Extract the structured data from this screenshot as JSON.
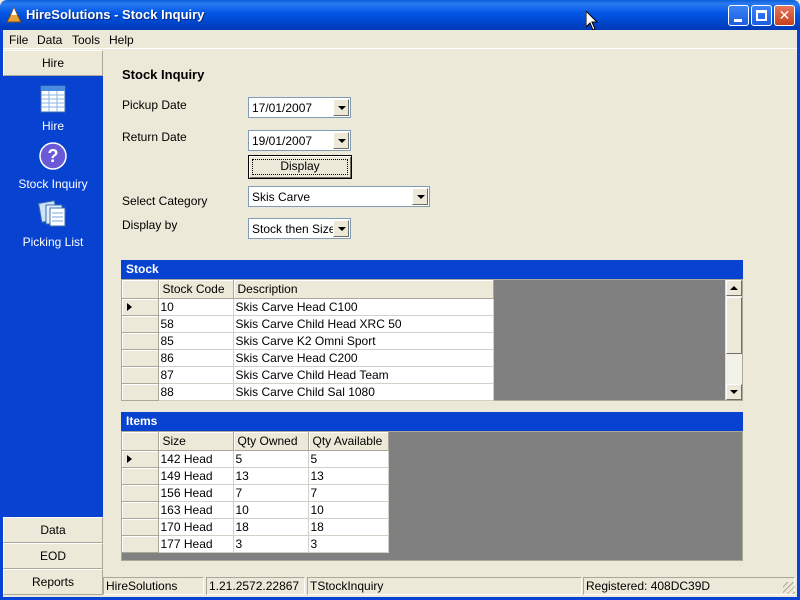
{
  "window": {
    "title": "HireSolutions - Stock Inquiry"
  },
  "menu": [
    "File",
    "Data",
    "Tools",
    "Help"
  ],
  "nav": {
    "top_header": "Hire",
    "links": [
      {
        "label": "Hire",
        "icon": "spreadsheet-icon"
      },
      {
        "label": "Stock Inquiry",
        "icon": "question-icon"
      },
      {
        "label": "Picking List",
        "icon": "documents-icon"
      }
    ],
    "bottom_headers": [
      "Data",
      "EOD",
      "Reports"
    ]
  },
  "form": {
    "heading": "Stock Inquiry",
    "pickup_label": "Pickup Date",
    "pickup_value": "17/01/2007",
    "return_label": "Return Date",
    "return_value": "19/01/2007",
    "display_button": "Display",
    "category_label": "Select Category",
    "category_value": "Skis Carve",
    "displayby_label": "Display by",
    "displayby_value": "Stock then Size"
  },
  "stock": {
    "title": "Stock",
    "columns": [
      "Stock Code",
      "Description"
    ],
    "rows": [
      [
        "10",
        "Skis Carve Head C100"
      ],
      [
        "58",
        "Skis Carve Child Head XRC 50"
      ],
      [
        "85",
        "Skis Carve K2 Omni Sport"
      ],
      [
        "86",
        "Skis Carve Head C200"
      ],
      [
        "87",
        "Skis Carve Child Head Team"
      ],
      [
        "88",
        "Skis Carve Child Sal 1080"
      ]
    ]
  },
  "items": {
    "title": "Items",
    "columns": [
      "Size",
      "Qty Owned",
      "Qty Available"
    ],
    "rows": [
      [
        "142 Head",
        "5",
        "5"
      ],
      [
        "149 Head",
        "13",
        "13"
      ],
      [
        "156 Head",
        "7",
        "7"
      ],
      [
        "163 Head",
        "10",
        "10"
      ],
      [
        "170 Head",
        "18",
        "18"
      ],
      [
        "177 Head",
        "3",
        "3"
      ]
    ]
  },
  "status": {
    "app": "HireSolutions",
    "version": "1.21.2572.22867",
    "form": "TStockInquiry",
    "registered": "Registered: 408DC39D"
  },
  "colors": {
    "nav_blue": "#0842d0",
    "titlebar_blue": "#0055e5",
    "grid_empty": "#808080"
  }
}
